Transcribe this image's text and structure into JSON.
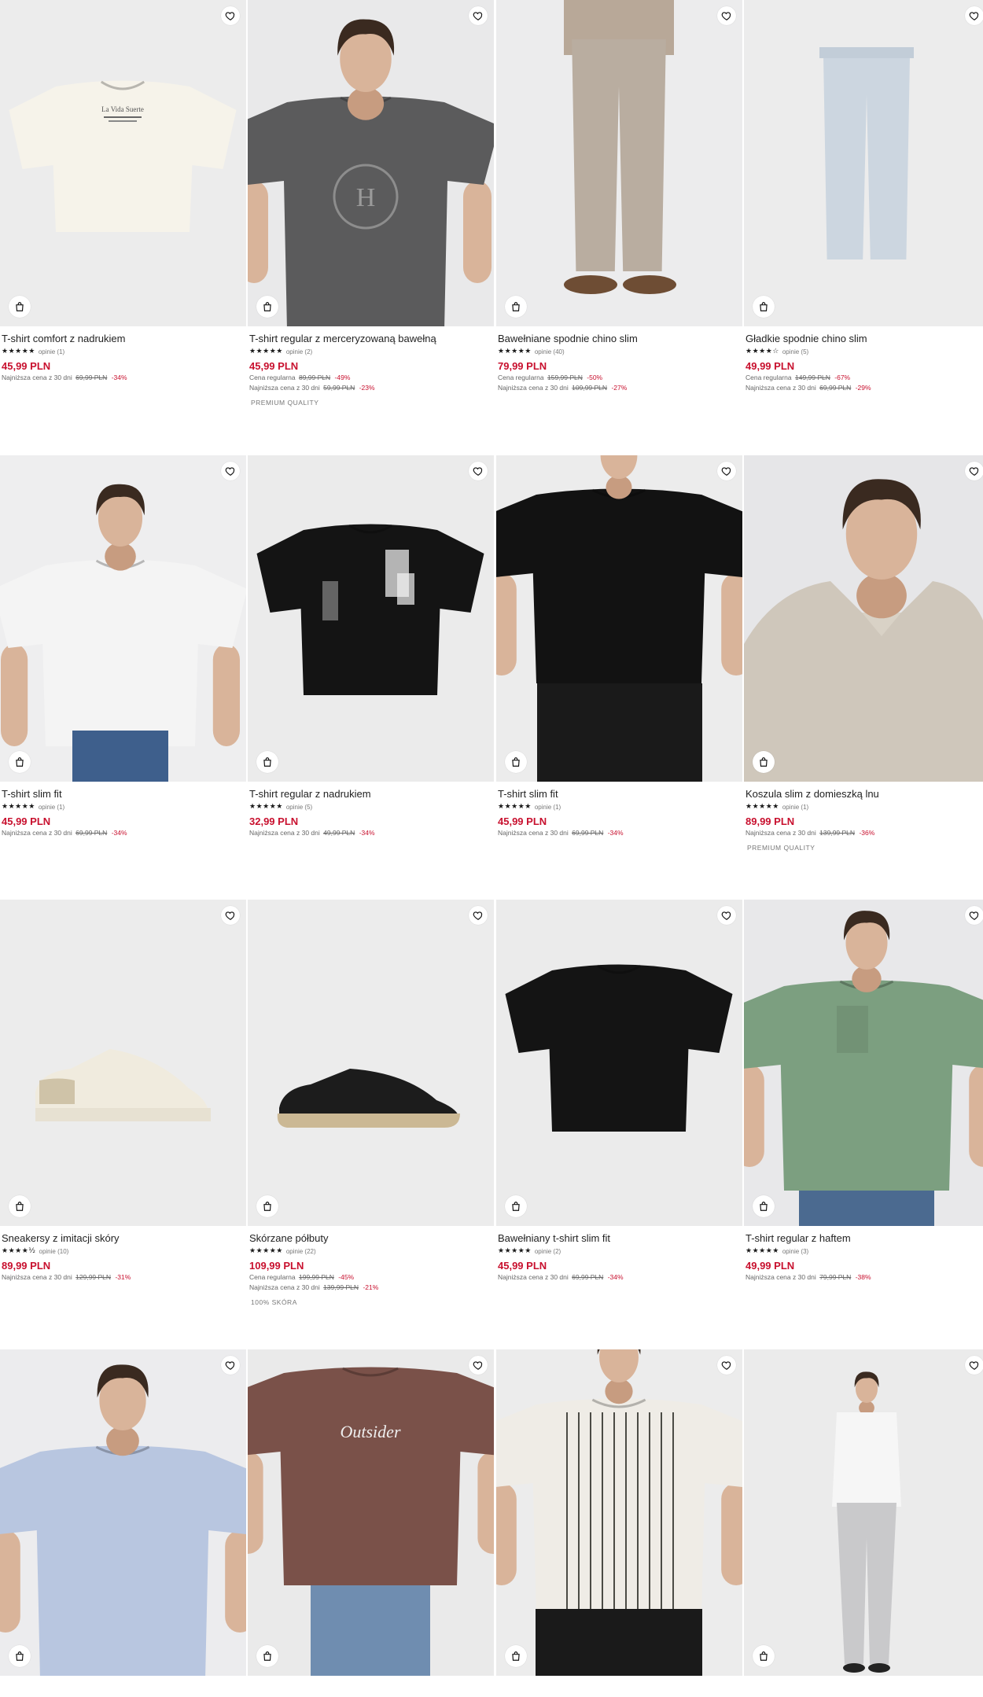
{
  "products": [
    {
      "title": "T-shirt comfort z nadrukiem",
      "stars": "★★★★★",
      "reviews": "opinie (1)",
      "price": "45,99 PLN",
      "lines": [
        {
          "label": "Najniższa cena z 30 dni",
          "old": "69,99 PLN",
          "disc": "-34%"
        }
      ],
      "tag": "",
      "icon": "t-shirt-white-product-image"
    },
    {
      "title": "T-shirt regular z merceryzowaną bawełną",
      "stars": "★★★★★",
      "reviews": "opinie (2)",
      "price": "45,99 PLN",
      "lines": [
        {
          "label": "Cena regularna",
          "old": "89,99 PLN",
          "disc": "-49%"
        },
        {
          "label": "Najniższa cena z 30 dni",
          "old": "59,99 PLN",
          "disc": "-23%"
        }
      ],
      "tag": "PREMIUM QUALITY",
      "icon": "model-grey-tshirt-image"
    },
    {
      "title": "Bawełniane spodnie chino slim",
      "stars": "★★★★★",
      "reviews": "opinie (40)",
      "price": "79,99 PLN",
      "lines": [
        {
          "label": "Cena regularna",
          "old": "159,99 PLN",
          "disc": "-50%"
        },
        {
          "label": "Najniższa cena z 30 dni",
          "old": "109,99 PLN",
          "disc": "-27%"
        }
      ],
      "tag": "",
      "icon": "model-beige-chinos-image"
    },
    {
      "title": "Gładkie spodnie chino slim",
      "stars": "★★★★☆",
      "reviews": "opinie (5)",
      "price": "49,99 PLN",
      "lines": [
        {
          "label": "Cena regularna",
          "old": "149,99 PLN",
          "disc": "-67%"
        },
        {
          "label": "Najniższa cena z 30 dni",
          "old": "69,99 PLN",
          "disc": "-29%"
        }
      ],
      "tag": "",
      "icon": "light-blue-chinos-image"
    },
    {
      "title": "T-shirt slim fit",
      "stars": "★★★★★",
      "reviews": "opinie (1)",
      "price": "45,99 PLN",
      "lines": [
        {
          "label": "Najniższa cena z 30 dni",
          "old": "69,99 PLN",
          "disc": "-34%"
        }
      ],
      "tag": "",
      "icon": "model-white-tshirt-image"
    },
    {
      "title": "T-shirt regular z nadrukiem",
      "stars": "★★★★★",
      "reviews": "opinie (5)",
      "price": "32,99 PLN",
      "lines": [
        {
          "label": "Najniższa cena z 30 dni",
          "old": "49,99 PLN",
          "disc": "-34%"
        }
      ],
      "tag": "",
      "icon": "black-print-tshirt-image"
    },
    {
      "title": "T-shirt slim fit",
      "stars": "★★★★★",
      "reviews": "opinie (1)",
      "price": "45,99 PLN",
      "lines": [
        {
          "label": "Najniższa cena z 30 dni",
          "old": "69,99 PLN",
          "disc": "-34%"
        }
      ],
      "tag": "",
      "icon": "model-black-tshirt-image"
    },
    {
      "title": "Koszula slim z domieszką lnu",
      "stars": "★★★★★",
      "reviews": "opinie (1)",
      "price": "89,99 PLN",
      "lines": [
        {
          "label": "Najniższa cena z 30 dni",
          "old": "139,99 PLN",
          "disc": "-36%"
        }
      ],
      "tag": "PREMIUM QUALITY",
      "icon": "model-linen-shirt-image"
    },
    {
      "title": "Sneakersy z imitacji skóry",
      "stars": "★★★★½",
      "reviews": "opinie (10)",
      "price": "89,99 PLN",
      "lines": [
        {
          "label": "Najniższa cena z 30 dni",
          "old": "129,99 PLN",
          "disc": "-31%"
        }
      ],
      "tag": "",
      "icon": "white-sneaker-image"
    },
    {
      "title": "Skórzane półbuty",
      "stars": "★★★★★",
      "reviews": "opinie (22)",
      "price": "109,99 PLN",
      "lines": [
        {
          "label": "Cena regularna",
          "old": "199,99 PLN",
          "disc": "-45%"
        },
        {
          "label": "Najniższa cena z 30 dni",
          "old": "139,99 PLN",
          "disc": "-21%"
        }
      ],
      "tag": "100% SKÓRA",
      "icon": "black-suede-shoe-image"
    },
    {
      "title": "Bawełniany t-shirt slim fit",
      "stars": "★★★★★",
      "reviews": "opinie (2)",
      "price": "45,99 PLN",
      "lines": [
        {
          "label": "Najniższa cena z 30 dni",
          "old": "69,99 PLN",
          "disc": "-34%"
        }
      ],
      "tag": "",
      "icon": "black-tshirt-flat-image"
    },
    {
      "title": "T-shirt regular z haftem",
      "stars": "★★★★★",
      "reviews": "opinie (3)",
      "price": "49,99 PLN",
      "lines": [
        {
          "label": "Najniższa cena z 30 dni",
          "old": "79,99 PLN",
          "disc": "-38%"
        }
      ],
      "tag": "",
      "icon": "model-green-tshirt-image"
    },
    {
      "title": "",
      "stars": "",
      "reviews": "",
      "price": "",
      "lines": [],
      "tag": "",
      "icon": "model-blue-shirt-image"
    },
    {
      "title": "",
      "stars": "",
      "reviews": "",
      "price": "",
      "lines": [],
      "tag": "",
      "icon": "model-brown-tshirt-image"
    },
    {
      "title": "",
      "stars": "",
      "reviews": "",
      "price": "",
      "lines": [],
      "tag": "",
      "icon": "model-striped-polo-image"
    },
    {
      "title": "",
      "stars": "",
      "reviews": "",
      "price": "",
      "lines": [],
      "tag": "",
      "icon": "model-white-shirt-image"
    }
  ],
  "icons": {
    "favorite": "heart-icon",
    "cart": "shopping-bag-icon"
  },
  "colors": {
    "price": "#c8102e",
    "discount": "#c8102e"
  }
}
